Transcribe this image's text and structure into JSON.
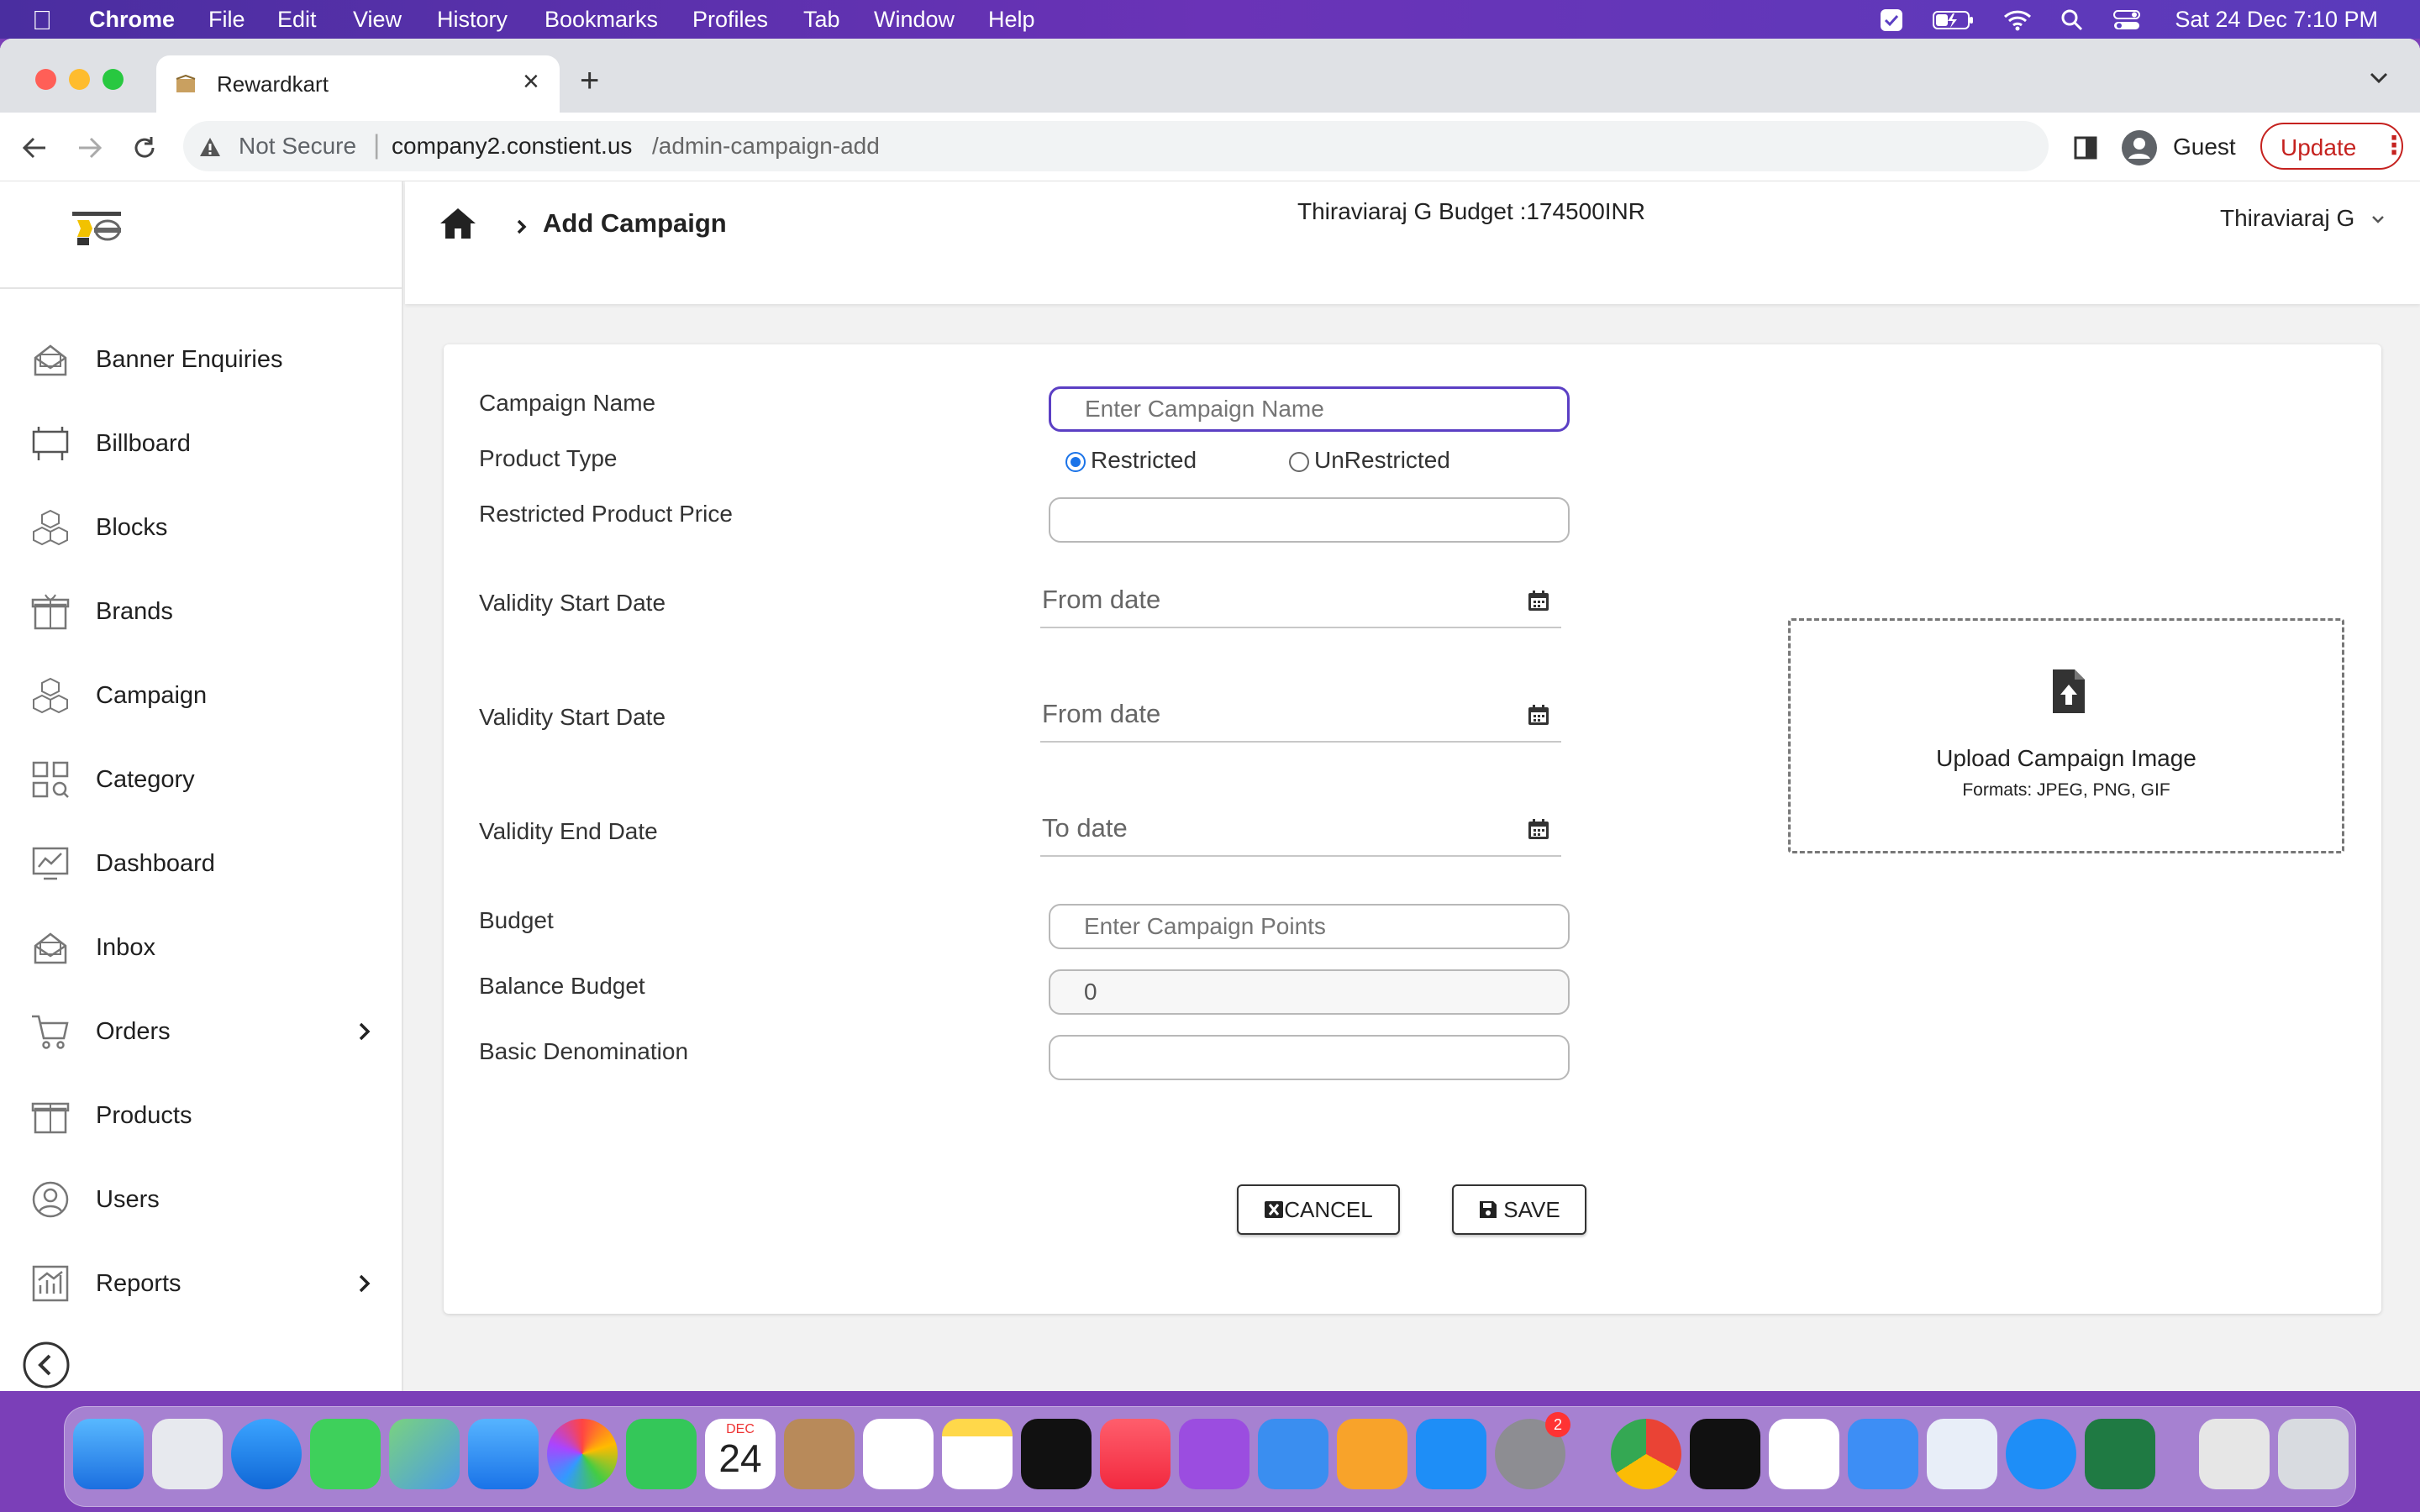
{
  "menubar": {
    "app": "Chrome",
    "items": [
      "File",
      "Edit",
      "View",
      "History",
      "Bookmarks",
      "Profiles",
      "Tab",
      "Window",
      "Help"
    ],
    "datetime": "Sat 24 Dec  7:10 PM"
  },
  "browser": {
    "tab_title": "Rewardkart",
    "security_label": "Not Secure",
    "url_host": "company2.constient.us",
    "url_path": "/admin-campaign-add",
    "profile_label": "Guest",
    "update_label": "Update"
  },
  "sidebar": {
    "items": [
      {
        "label": "Banner Enquiries",
        "icon": "banner-icon"
      },
      {
        "label": "Billboard",
        "icon": "billboard-icon"
      },
      {
        "label": "Blocks",
        "icon": "blocks-icon"
      },
      {
        "label": "Brands",
        "icon": "brands-icon"
      },
      {
        "label": "Campaign",
        "icon": "campaign-icon"
      },
      {
        "label": "Category",
        "icon": "category-icon"
      },
      {
        "label": "Dashboard",
        "icon": "dashboard-icon"
      },
      {
        "label": "Inbox",
        "icon": "inbox-icon"
      },
      {
        "label": "Orders",
        "icon": "cart-icon"
      },
      {
        "label": "Products",
        "icon": "products-icon"
      },
      {
        "label": "Users",
        "icon": "user-icon"
      },
      {
        "label": "Reports",
        "icon": "reports-icon"
      }
    ]
  },
  "header": {
    "breadcrumb": "Add Campaign",
    "budget": "Thiraviaraj G Budget :174500INR",
    "user": "Thiraviaraj G"
  },
  "form": {
    "campaign_name_label": "Campaign Name",
    "campaign_name_placeholder": "Enter Campaign Name",
    "product_type_label": "Product Type",
    "restricted_label": "Restricted",
    "unrestricted_label": "UnRestricted",
    "restricted_price_label": "Restricted Product Price",
    "validity_start_label_1": "Validity Start Date",
    "validity_start_label_2": "Validity Start Date",
    "validity_end_label": "Validity End Date",
    "from_date_1": "From date",
    "from_date_2": "From date",
    "to_date": "To date",
    "budget_label": "Budget",
    "budget_placeholder": "Enter Campaign Points",
    "balance_label": "Balance Budget",
    "balance_value": "0",
    "denomination_label": "Basic Denomination",
    "cancel_label": "CANCEL",
    "save_label": "SAVE"
  },
  "upload": {
    "title": "Upload Campaign Image",
    "formats": "Formats: JPEG, PNG, GIF"
  },
  "dock": {
    "calendar_month": "DEC",
    "calendar_day": "24",
    "badge": "2"
  },
  "colors": {
    "accent_purple": "#5b3fc4",
    "update_red": "#c5221f",
    "radio_blue": "#1a73e8"
  }
}
